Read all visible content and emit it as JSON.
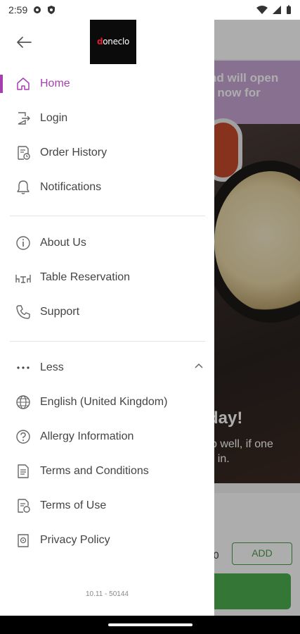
{
  "status_bar": {
    "time": "2:59",
    "left_icons": [
      "gear-icon",
      "shield-icon"
    ],
    "right_icons": [
      "wifi-icon",
      "signal-icon",
      "battery-icon"
    ]
  },
  "background_app": {
    "banner_text_line1": "nd will open",
    "banner_text_line2": "r now for",
    "headline": "day!",
    "sub_line1": "p well, if one",
    "sub_line2": "r in.",
    "price_fragment": "50",
    "add_button": "ADD",
    "accent_color": "#4caf50",
    "banner_color": "#c9a5d6"
  },
  "drawer": {
    "logo_prefix": "d",
    "logo_text": "oneclo",
    "primary_items": [
      {
        "label": "Home",
        "icon": "home-icon",
        "active": true
      },
      {
        "label": "Login",
        "icon": "login-icon"
      },
      {
        "label": "Order History",
        "icon": "receipt-icon"
      },
      {
        "label": "Notifications",
        "icon": "bell-icon"
      }
    ],
    "secondary_items": [
      {
        "label": "About Us",
        "icon": "info-icon"
      },
      {
        "label": "Table Reservation",
        "icon": "table-icon"
      },
      {
        "label": "Support",
        "icon": "phone-icon"
      }
    ],
    "less_label": "Less",
    "tertiary_items": [
      {
        "label": "English (United Kingdom)",
        "icon": "globe-icon"
      },
      {
        "label": "Allergy Information",
        "icon": "question-icon"
      },
      {
        "label": "Terms and Conditions",
        "icon": "document-icon"
      },
      {
        "label": "Terms of Use",
        "icon": "document-check-icon"
      },
      {
        "label": "Privacy Policy",
        "icon": "privacy-icon"
      }
    ],
    "version": "10.11 - 50144",
    "accent_color": "#a53fb0"
  }
}
